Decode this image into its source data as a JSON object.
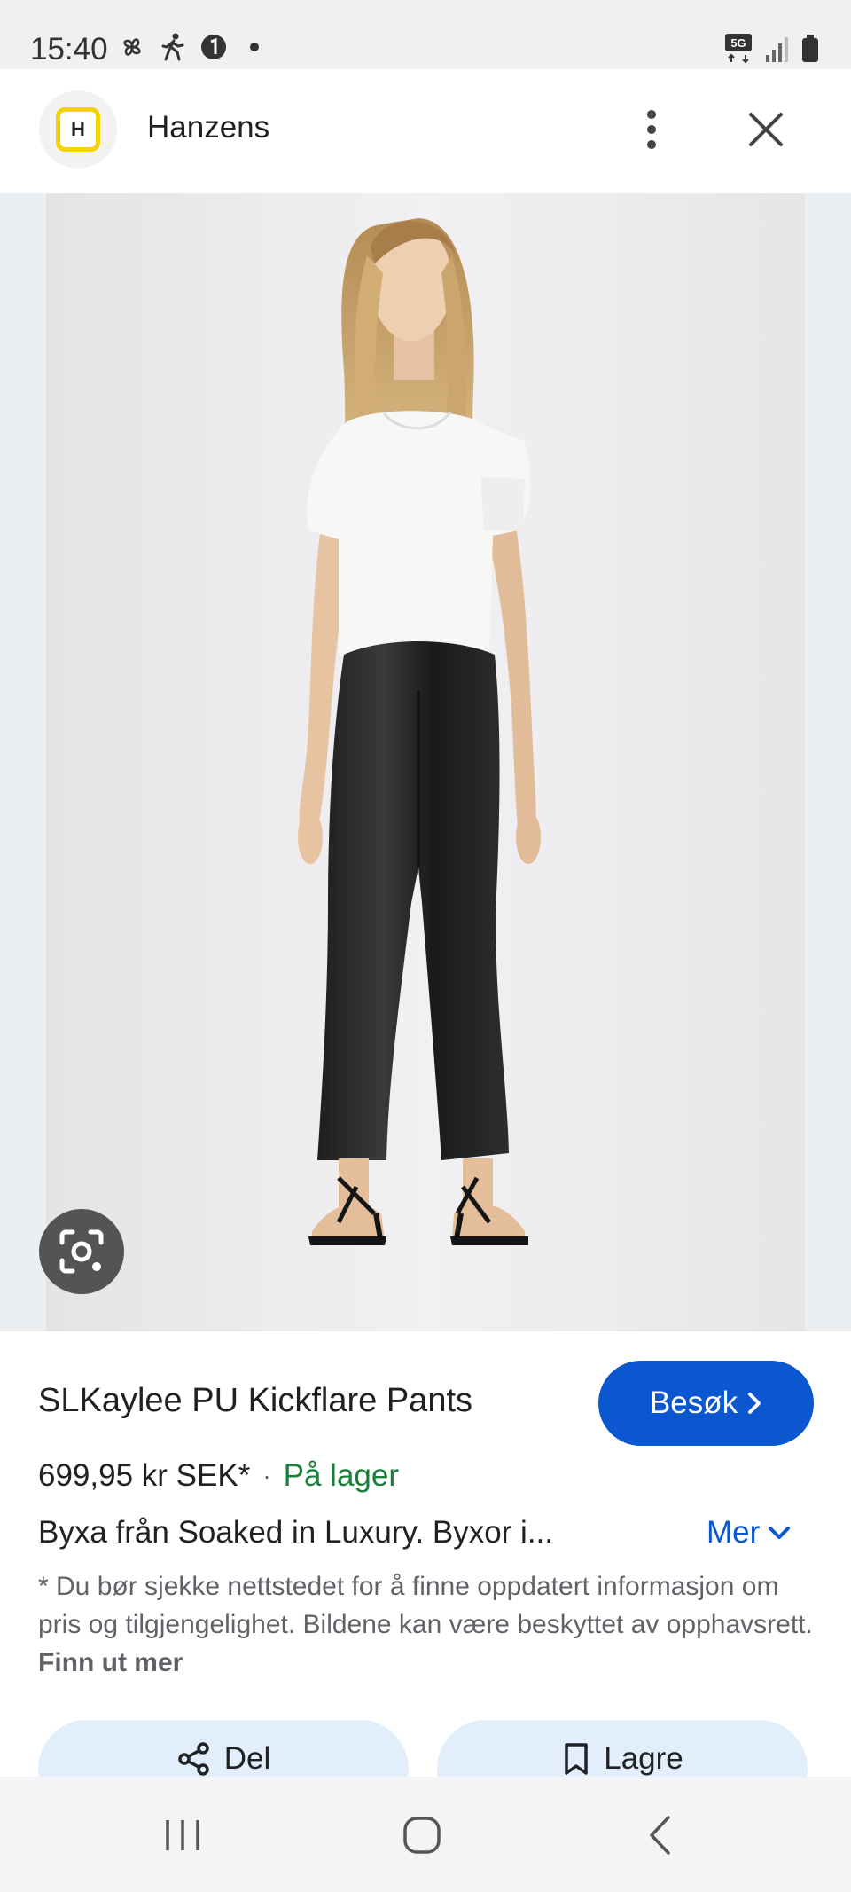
{
  "status_bar": {
    "time": "15:40",
    "left_icons": [
      "pinwheel-icon",
      "walking-person-icon",
      "notification-badge-icon",
      "dot-icon"
    ],
    "right_icons": [
      "5g-icon",
      "signal-icon",
      "battery-icon"
    ],
    "network": "5G"
  },
  "header": {
    "site_name": "Hanzens",
    "logo_letter": "H"
  },
  "product": {
    "title": "SLKaylee PU Kickflare Pants",
    "visit_label": "Besøk",
    "price": "699,95 kr SEK*",
    "separator": "·",
    "stock": "På lager",
    "description": "Byxa från Soaked in Luxury. Byxor i...",
    "more_label": "Mer",
    "disclaimer": "* Du bør sjekke nettstedet for å finne oppdatert informasjon om pris og tilgjengelighet. Bildene kan være beskyttet av opphavsrett.",
    "learn_more": "Finn ut mer"
  },
  "actions": {
    "share_label": "Del",
    "save_label": "Lagre"
  },
  "colors": {
    "accent": "#0b57d0",
    "stock_green": "#188038",
    "action_bg": "#e3eefd",
    "logo_yellow": "#f4d400"
  }
}
